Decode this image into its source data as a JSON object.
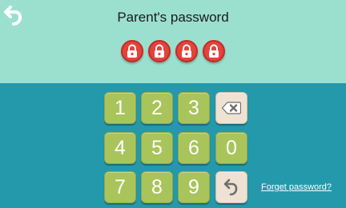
{
  "header": {
    "title": "Parent's password",
    "back_icon": "back-arrow-icon"
  },
  "locks": {
    "count": 4,
    "icon": "padlock-icon",
    "color": "#e4433c"
  },
  "keypad": {
    "keys": [
      "1",
      "2",
      "3",
      "4",
      "5",
      "6",
      "0",
      "7",
      "8",
      "9"
    ],
    "delete_icon": "backspace-icon",
    "return_icon": "return-arrow-icon",
    "number_color": "#a9c45b",
    "function_color": "#efe2d3"
  },
  "forget_password": {
    "label": "Forget password?"
  },
  "colors": {
    "header_background": "#9bdfcf",
    "body_background": "#2499ab"
  }
}
